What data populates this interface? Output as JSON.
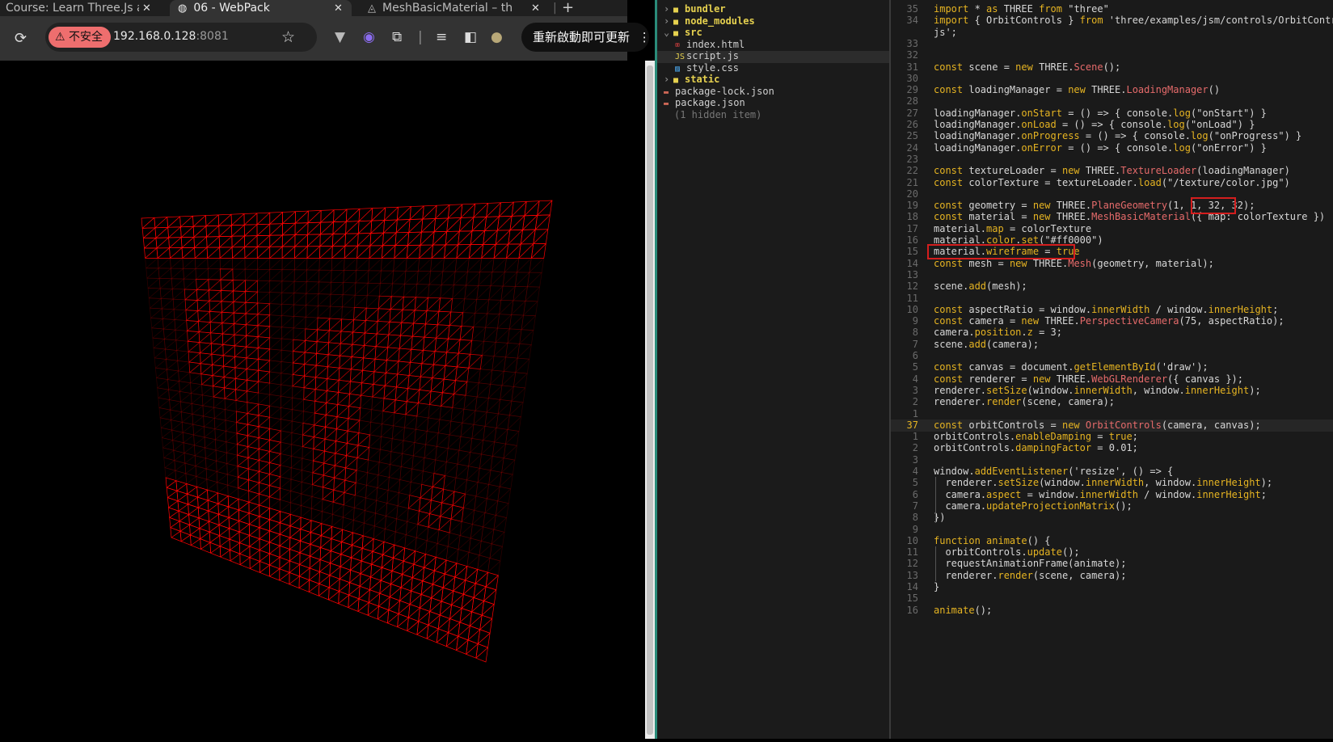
{
  "browser": {
    "tabs": [
      {
        "title": "Course: Learn Three.Js a",
        "active": false
      },
      {
        "title": "06 - WebPack",
        "active": true
      },
      {
        "title": "MeshBasicMaterial – thr",
        "active": false
      }
    ],
    "close_glyph": "✕",
    "new_tab_glyph": "+",
    "security_label": "不安全",
    "url_host": "192.168.0.128",
    "url_port": ":8081",
    "update_label": "重新啟動即可更新",
    "icons": [
      "reload-icon",
      "star-icon",
      "vue-devtools-icon",
      "extension-icon",
      "puzzle-icon",
      "media-queue-icon",
      "side-panel-icon",
      "profile-avatar-icon",
      "menu-kebab-icon"
    ]
  },
  "scene": {
    "wireframe_color": "#ff0000",
    "segments": 32
  },
  "explorer": {
    "items": [
      {
        "name": "bundler",
        "type": "folder",
        "collapsed": true
      },
      {
        "name": "node_modules",
        "type": "folder",
        "collapsed": true
      },
      {
        "name": "src",
        "type": "folder",
        "collapsed": false
      },
      {
        "name": "index.html",
        "type": "html-file"
      },
      {
        "name": "script.js",
        "type": "js-file"
      },
      {
        "name": "style.css",
        "type": "css-file"
      },
      {
        "name": "static",
        "type": "folder",
        "collapsed": true
      },
      {
        "name": "package-lock.json",
        "type": "json-file"
      },
      {
        "name": "package.json",
        "type": "json-file"
      },
      {
        "name": "(1 hidden item)",
        "type": "hidden"
      }
    ]
  },
  "editor": {
    "lines": [
      {
        "n": "35",
        "text": "import * as THREE from \"three\""
      },
      {
        "n": "34",
        "text": "import { OrbitControls } from 'three/examples/jsm/controls/OrbitControls."
      },
      {
        "n": "",
        "text": "js';"
      },
      {
        "n": "33",
        "text": ""
      },
      {
        "n": "32",
        "text": ""
      },
      {
        "n": "31",
        "text": "const scene = new THREE.Scene();"
      },
      {
        "n": "30",
        "text": ""
      },
      {
        "n": "29",
        "text": "const loadingManager = new THREE.LoadingManager()"
      },
      {
        "n": "28",
        "text": ""
      },
      {
        "n": "27",
        "text": "loadingManager.onStart = () => { console.log(\"onStart\") }"
      },
      {
        "n": "26",
        "text": "loadingManager.onLoad = () => { console.log(\"onLoad\") }"
      },
      {
        "n": "25",
        "text": "loadingManager.onProgress = () => { console.log(\"onProgress\") }"
      },
      {
        "n": "24",
        "text": "loadingManager.onError = () => { console.log(\"onError\") }"
      },
      {
        "n": "23",
        "text": ""
      },
      {
        "n": "22",
        "text": "const textureLoader = new THREE.TextureLoader(loadingManager)"
      },
      {
        "n": "21",
        "text": "const colorTexture = textureLoader.load(\"/texture/color.jpg\")"
      },
      {
        "n": "20",
        "text": ""
      },
      {
        "n": "19",
        "text": "const geometry = new THREE.PlaneGeometry(1, 1, 32, 32);"
      },
      {
        "n": "18",
        "text": "const material = new THREE.MeshBasicMaterial({ map: colorTexture })"
      },
      {
        "n": "17",
        "text": "material.map = colorTexture"
      },
      {
        "n": "16",
        "text": "material.color.set(\"#ff0000\")"
      },
      {
        "n": "15",
        "text": "material.wireframe = true"
      },
      {
        "n": "14",
        "text": "const mesh = new THREE.Mesh(geometry, material);"
      },
      {
        "n": "13",
        "text": ""
      },
      {
        "n": "12",
        "text": "scene.add(mesh);"
      },
      {
        "n": "11",
        "text": ""
      },
      {
        "n": "10",
        "text": "const aspectRatio = window.innerWidth / window.innerHeight;"
      },
      {
        "n": "9",
        "text": "const camera = new THREE.PerspectiveCamera(75, aspectRatio);"
      },
      {
        "n": "8",
        "text": "camera.position.z = 3;"
      },
      {
        "n": "7",
        "text": "scene.add(camera);"
      },
      {
        "n": "6",
        "text": ""
      },
      {
        "n": "5",
        "text": "const canvas = document.getElementById('draw');"
      },
      {
        "n": "4",
        "text": "const renderer = new THREE.WebGLRenderer({ canvas });"
      },
      {
        "n": "3",
        "text": "renderer.setSize(window.innerWidth, window.innerHeight);"
      },
      {
        "n": "2",
        "text": "renderer.render(scene, camera);"
      },
      {
        "n": "1",
        "text": ""
      },
      {
        "n": "37",
        "text": "const orbitControls = new OrbitControls(camera, canvas);",
        "current": true
      },
      {
        "n": "1",
        "text": "orbitControls.enableDamping = true;"
      },
      {
        "n": "2",
        "text": "orbitControls.dampingFactor = 0.01;"
      },
      {
        "n": "3",
        "text": ""
      },
      {
        "n": "4",
        "text": "window.addEventListener('resize', () => {"
      },
      {
        "n": "5",
        "text": "  renderer.setSize(window.innerWidth, window.innerHeight);"
      },
      {
        "n": "6",
        "text": "  camera.aspect = window.innerWidth / window.innerHeight;"
      },
      {
        "n": "7",
        "text": "  camera.updateProjectionMatrix();"
      },
      {
        "n": "8",
        "text": "})"
      },
      {
        "n": "9",
        "text": ""
      },
      {
        "n": "10",
        "text": "function animate() {"
      },
      {
        "n": "11",
        "text": "  orbitControls.update();"
      },
      {
        "n": "12",
        "text": "  requestAnimationFrame(animate);"
      },
      {
        "n": "13",
        "text": "  renderer.render(scene, camera);"
      },
      {
        "n": "14",
        "text": "}"
      },
      {
        "n": "15",
        "text": ""
      },
      {
        "n": "16",
        "text": "animate();"
      }
    ],
    "colors": {
      "keyword": "#e6b422",
      "string": "#d7d7d7",
      "type": "#e66b6b",
      "method": "#e6b422",
      "plain": "#d7d7d7",
      "highlight_box": "#d41e1e",
      "current_line_number": "#e6b422"
    }
  }
}
